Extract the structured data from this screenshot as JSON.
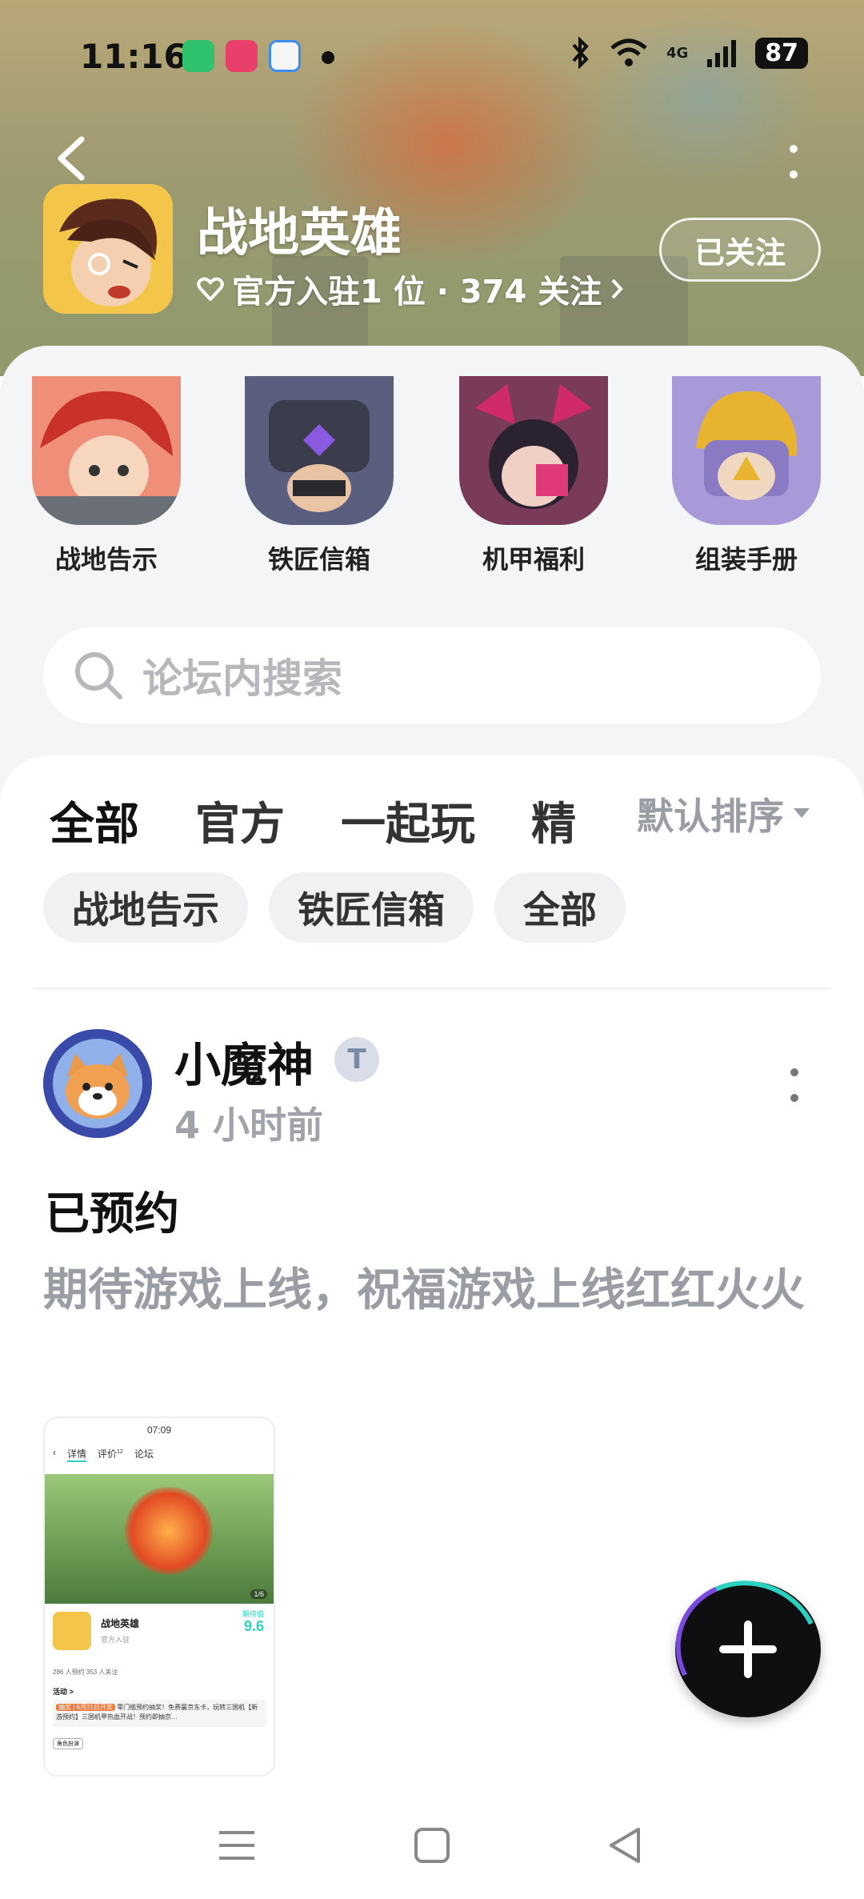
{
  "status_bar": {
    "time": "11:16",
    "battery": "87",
    "network": "4G"
  },
  "header": {
    "game_title": "战地英雄",
    "meta": "官方入驻1 位 · 374 关注",
    "follow_label": "已关注"
  },
  "shortcuts": [
    {
      "label": "战地告示"
    },
    {
      "label": "铁匠信箱"
    },
    {
      "label": "机甲福利"
    },
    {
      "label": "组装手册"
    }
  ],
  "search": {
    "placeholder": "论坛内搜索"
  },
  "tabs": [
    {
      "label": "全部",
      "active": true
    },
    {
      "label": "官方"
    },
    {
      "label": "一起玩"
    },
    {
      "label": "精"
    }
  ],
  "sort": {
    "label": "默认排序"
  },
  "chips": [
    {
      "label": "战地告示"
    },
    {
      "label": "铁匠信箱"
    },
    {
      "label": "全部"
    }
  ],
  "post": {
    "author": "小魔神",
    "time": "4 小时前",
    "title": "已预约",
    "body": "期待游戏上线，祝福游戏上线红红火火",
    "image": {
      "time": "07:09",
      "tabs": [
        "详情",
        "评价",
        "论坛"
      ],
      "eval_count": "12",
      "game_name": "战地英雄",
      "official": "官方入驻",
      "score_label": "期待值",
      "score": "9.6",
      "stats": "286 人预约    353 人关注",
      "page": "1/6",
      "activity_label": "活动 >",
      "activity_tag": "抽奖 | 6月21日开奖",
      "activity_text": "零门槛预约抽奖！免费赢京东卡，玩转三国机【新游预约】三国机甲热血开战！预约即抽京…",
      "role_tag": "角色扮演"
    }
  },
  "colors": {
    "accent": "#2cd0be",
    "fab": "#0f0f12",
    "muted_text": "#9a9ea4"
  }
}
